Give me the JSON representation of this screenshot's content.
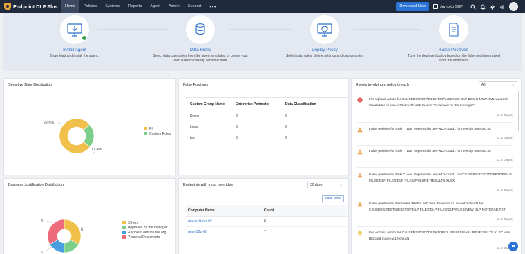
{
  "app": {
    "name": "Endpoint DLP Plus"
  },
  "nav": {
    "items": [
      "Home",
      "Policies",
      "Systems",
      "Reports",
      "Agent",
      "Admin",
      "Support"
    ],
    "active": "Home",
    "more_label": "•••",
    "download_label": "Download Now",
    "jump_label": "Jump to SDP"
  },
  "steps": [
    {
      "title": "Install Agent",
      "desc": "Download and install the agent.",
      "icon": "monitor-download-icon",
      "completed": true
    },
    {
      "title": "Data Rules",
      "desc": "Select data categories from the given templates or create your own rules to classify sensitive data",
      "icon": "data-rules-icon",
      "completed": false
    },
    {
      "title": "Deploy Policy",
      "desc": "Select data rules, define settings and deploy policy",
      "icon": "deploy-policy-icon",
      "completed": false
    },
    {
      "title": "False Positives",
      "desc": "Tune the deployed policy based on the false positives raised from the endpoints",
      "icon": "false-positives-icon",
      "completed": false
    }
  ],
  "sensitive": {
    "title": "Sensitive Data Distribution",
    "labels": [
      "22.6%",
      "77.4%"
    ],
    "legend": [
      {
        "label": "PII",
        "color": "#f0c04a"
      },
      {
        "label": "Custom Rules",
        "color": "#7ccf8a"
      }
    ],
    "chart_data": {
      "type": "pie",
      "categories": [
        "PII",
        "Custom Rules"
      ],
      "values": [
        77.4,
        22.6
      ]
    }
  },
  "false_positives": {
    "title": "False Positives",
    "headers": [
      "Custom Group Name",
      "Enterprise Perimeter",
      "Data Classification"
    ],
    "rows": [
      [
        "Demo",
        "8",
        "6"
      ],
      [
        "Local",
        "3",
        "6"
      ],
      [
        "test",
        "3",
        "6"
      ]
    ]
  },
  "events": {
    "title": "Events involving a policy breach",
    "filter": "All",
    "items": [
      {
        "type": "error",
        "lines": [
          "File Upload action for C:\\USERS\\TEST\\DESKTOP\\LICENSE DLP DEMO NEW.XML was Self",
          "Overridden in ues-w10-cloud1 with reason \"Approved by the manager\""
        ],
        "time": "11.5 Day(s)"
      },
      {
        "type": "warning",
        "lines": [
          "False positive for Rule \"\" was Reported in ues-w10-cloud1 for new dlp notepad.txt"
        ],
        "time": "11.5 Day(s)"
      },
      {
        "type": "warning",
        "lines": [
          "False positive for Rule \"\" was Reported in ues-w10-cloud1 for new dlp notepad.txt"
        ],
        "time": "11.5 Day(s)"
      },
      {
        "type": "warning",
        "lines": [
          "False positive for Rule \"\" was Reported in ues-w10-cloud1 for C:\\USERS\\TEST\\DESKTOP\\DLP",
          "FILES\\DLP FILES\\DLP FILES\\FAILURE RESULTS.XLSX"
        ],
        "time": "11.5 Day(s)"
      },
      {
        "type": "warning",
        "lines": [
          "False positive for Perimeter \"Klebin.net\" was Reported in ues-w10-cloud1 for",
          "C:\\USERS\\TEST\\DESKTOP\\DLP FILES\\DLP FILES\\DLP FILES\\NEW DLP NOTEPAD.TXT"
        ],
        "time": "11.5 Day(s)"
      },
      {
        "type": "note",
        "lines": [
          "File Access action for C:\\USERS\\TEST\\DESKTOP\\DLP FILES\\FAILURE RESULTS.XLSX was",
          "Blocked in ues-w10-cloud1"
        ],
        "time": "11.5 Day(s)"
      }
    ]
  },
  "justification": {
    "title": "Business Justification Distribution",
    "labels": [
      "3",
      "6",
      "6"
    ],
    "legend": [
      {
        "label": "Others",
        "color": "#f0c04a"
      },
      {
        "label": "Approved by the manager",
        "color": "#7ccf8a"
      },
      {
        "label": "Recipient outside the org...",
        "color": "#4a9fe0"
      },
      {
        "label": "Personal Documents",
        "color": "#ee6b7c"
      }
    ],
    "chart_data": {
      "type": "pie",
      "categories": [
        "Others",
        "Approved by the manager",
        "Recipient outside the org...",
        "Personal Documents"
      ],
      "values": [
        6,
        3,
        3,
        6
      ]
    }
  },
  "overrides": {
    "title": "Endpoints with most overrides",
    "range": "30 days",
    "view_more": "View More",
    "headers": [
      "Computer Name",
      "Count"
    ],
    "rows": [
      [
        "ues-w10-cloud1",
        "8"
      ],
      [
        "uesw10v-x0",
        "7"
      ]
    ]
  }
}
